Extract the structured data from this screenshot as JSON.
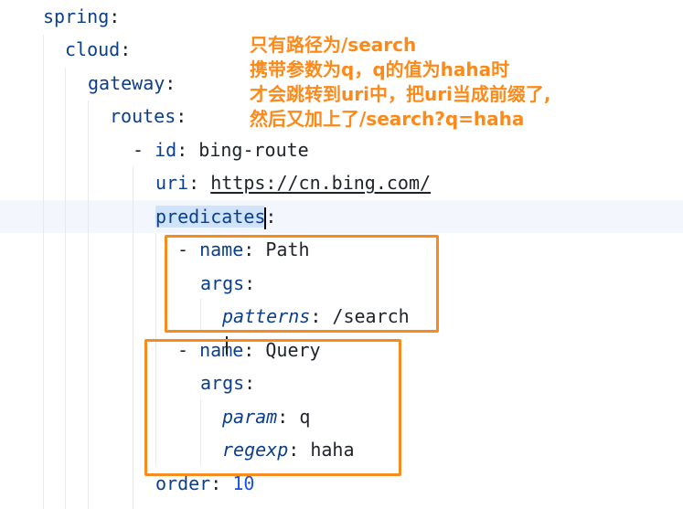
{
  "colors": {
    "key": "#0b3f8c",
    "annotation": "#f68c1e",
    "number": "#1750eb",
    "selection": "#cfe3fb"
  },
  "code": {
    "l1": {
      "key": "spring",
      "colon": ":"
    },
    "l2": {
      "key": "cloud",
      "colon": ":"
    },
    "l3": {
      "key": "gateway",
      "colon": ":"
    },
    "l4": {
      "key": "routes",
      "colon": ":"
    },
    "l5": {
      "dash": "- ",
      "key": "id",
      "colon": ": ",
      "value": "bing-route"
    },
    "l6": {
      "key": "uri",
      "colon": ": ",
      "value": "https://cn.bing.com/"
    },
    "l7": {
      "key": "predicates",
      "colon": ":"
    },
    "l8": {
      "dash": "- ",
      "key": "name",
      "colon": ": ",
      "value": "Path"
    },
    "l9": {
      "key": "args",
      "colon": ":"
    },
    "l10": {
      "key": "patterns",
      "colon": ": ",
      "value": "/search"
    },
    "l11": {
      "dash": "- ",
      "key_a": "na",
      "key_b": "me",
      "colon": ": ",
      "value": "Query"
    },
    "l12": {
      "key": "args",
      "colon": ":"
    },
    "l13": {
      "key": "param",
      "colon": ": ",
      "value": "q"
    },
    "l14": {
      "key": "regexp",
      "colon": ": ",
      "value": "haha"
    },
    "l15": {
      "key": "order",
      "colon": ": ",
      "value": "10"
    }
  },
  "annotation": {
    "lines": [
      "只有路径为/search",
      "携带参数为q，q的值为haha时",
      "才会跳转到uri中，把uri当成前缀了,",
      "然后又加上了/search?q=haha"
    ]
  }
}
